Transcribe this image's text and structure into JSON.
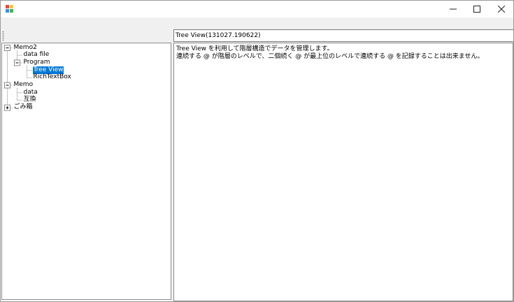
{
  "window": {
    "caption_buttons": {
      "minimize": "minimize-icon",
      "maximize": "maximize-icon",
      "close": "close-icon"
    }
  },
  "editor": {
    "title_value": "Tree View(131027.190622)",
    "content_lines": [
      "Tree View を利用して階層構造でデータを管理します。",
      "連続する @ が階層のレベルで、二個続く @ が最上位のレベルで連続する @ を記録することは出来ません。"
    ]
  },
  "tree": {
    "nodes": [
      {
        "label": "Memo2",
        "level": 0,
        "expander": "minus"
      },
      {
        "label": "data file",
        "level": 1,
        "expander": "none"
      },
      {
        "label": "Program",
        "level": 1,
        "expander": "minus"
      },
      {
        "label": "Tree View",
        "level": 2,
        "expander": "none",
        "selected": true
      },
      {
        "label": "RichTextBox",
        "level": 2,
        "expander": "none"
      },
      {
        "label": "Memo",
        "level": 0,
        "expander": "minus"
      },
      {
        "label": "data",
        "level": 1,
        "expander": "none"
      },
      {
        "label": "互換",
        "level": 1,
        "expander": "none"
      },
      {
        "label": "ごみ箱",
        "level": 0,
        "expander": "plus"
      }
    ]
  },
  "colors": {
    "selection": "#0078d7",
    "chrome": "#f0f0f0",
    "border": "#8c8c8c"
  }
}
